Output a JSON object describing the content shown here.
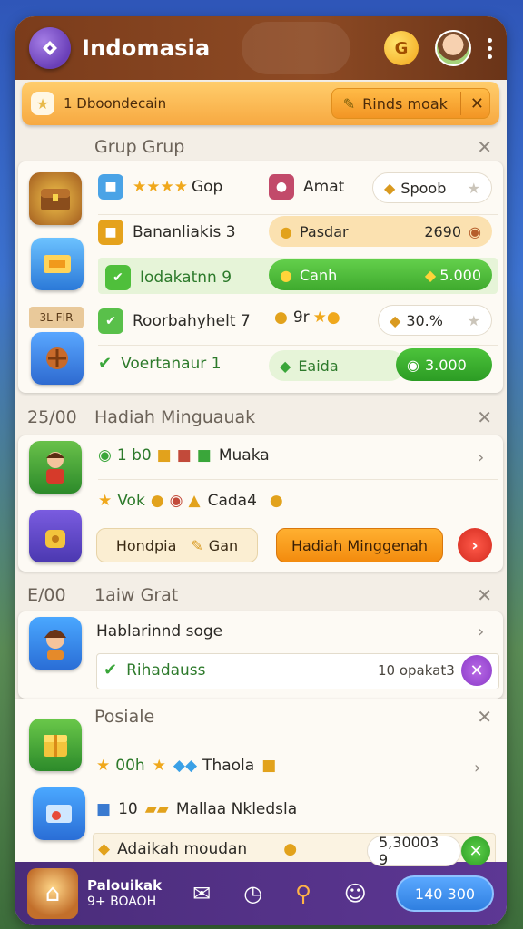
{
  "header": {
    "app_title": "Indomasia",
    "coin_symbol": "G",
    "icons": [
      "app-logo-icon",
      "coin-icon",
      "avatar",
      "more-icon"
    ]
  },
  "banner": {
    "text": "1 Dboondecain",
    "button_label": "Rinds moak",
    "close": "✕"
  },
  "section1": {
    "title": "Grup Grup",
    "close": "✕",
    "side_label": "3L FIR",
    "rows": [
      {
        "left": "Gop",
        "left_stars": "★★★★",
        "mid": "Amat",
        "right": "Spoob"
      },
      {
        "left": "Bananliakis 3",
        "mid": "Pasdar",
        "right": "2690"
      },
      {
        "left": "Iodakatnn 9",
        "mid": "Canh",
        "right": "5.000"
      },
      {
        "left": "Roorbahyhelt 7",
        "mid": "9r",
        "right": "30.%"
      },
      {
        "left": "Voertanaur 1",
        "mid": "Eaida",
        "right": "3.000"
      }
    ]
  },
  "section2": {
    "prefix": "25/00",
    "title": "Hadiah Minguauak",
    "close": "✕",
    "row1_count": "1 b0",
    "row1_label": "Muaka",
    "row2_left": "Vok",
    "row2_label": "Cada4",
    "btn_left": "Hondpia",
    "btn_left_sub": "Gan",
    "btn_main": "Hadiah Minggenah"
  },
  "section3": {
    "prefix": "E/00",
    "title": "1aiw Grat",
    "close": "✕",
    "row1_label": "Hablarinnd soge",
    "row2_label": "Rihadauss",
    "row2_right": "10 opakat3"
  },
  "section4": {
    "title": "Posiale",
    "close": "✕",
    "row1_left": "00h",
    "row1_label": "Thaola",
    "row2_count": "10",
    "row2_label": "Mallaa Nkledsla",
    "row3_label": "Adaikah moudan",
    "row3_value": "5,30003 9"
  },
  "bottom_bar": {
    "title": "Palouikak",
    "subtitle": "9+ BOAOH",
    "button_label": "140 300"
  },
  "colors": {
    "header": "#7b3c1b",
    "banner": "#f7a941",
    "green": "#4fbf3b",
    "orange": "#f38b0e",
    "purple": "#5d3794",
    "blue": "#2f7fe0"
  }
}
